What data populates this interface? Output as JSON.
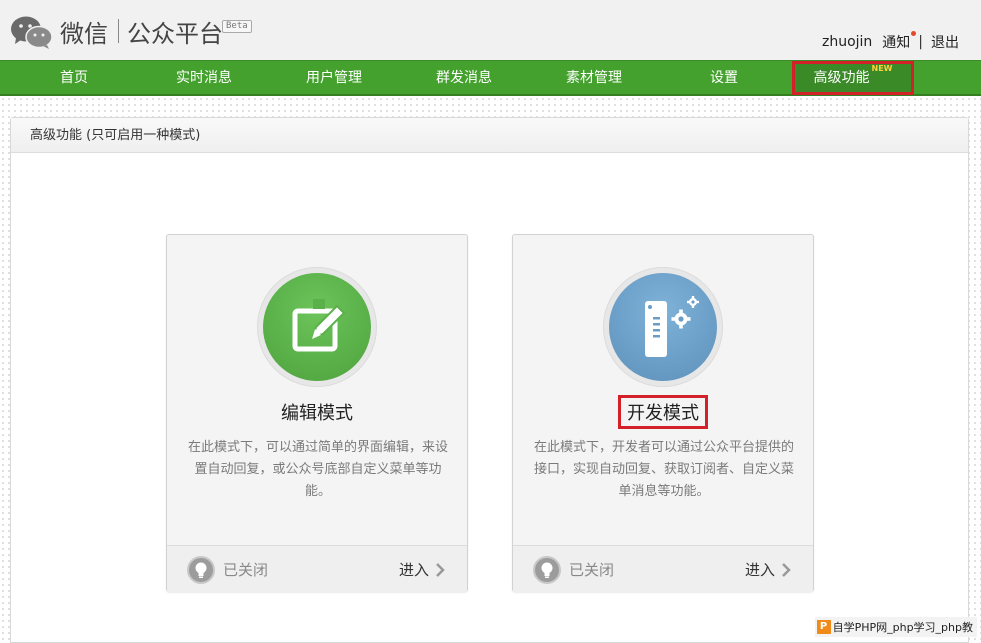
{
  "header": {
    "brand_name": "微信",
    "platform_name": "公众平台",
    "beta_label": "Beta",
    "username": "zhuojin",
    "notice_label": "通知",
    "pipe": "|",
    "logout_label": "退出"
  },
  "nav": {
    "items": [
      {
        "label": "首页"
      },
      {
        "label": "实时消息"
      },
      {
        "label": "用户管理"
      },
      {
        "label": "群发消息"
      },
      {
        "label": "素材管理"
      },
      {
        "label": "设置"
      },
      {
        "label": "高级功能",
        "badge": "NEW",
        "active": true
      }
    ],
    "bar_color": "#44a12e",
    "highlight_color": "#d3212a"
  },
  "panel": {
    "title": "高级功能 (只可启用一种模式)"
  },
  "cards": [
    {
      "title": "编辑模式",
      "description": "在此模式下，可以通过简单的界面编辑，来设置自动回复，或公众号底部自定义菜单等功能。",
      "status": "已关闭",
      "enter_label": "进入",
      "icon": "edit-icon",
      "color": "#55aa44"
    },
    {
      "title": "开发模式",
      "description": "在此模式下，开发者可以通过公众平台提供的接口，实现自动回复、获取订阅者、自定义菜单消息等功能。",
      "status": "已关闭",
      "enter_label": "进入",
      "icon": "server-gear-icon",
      "color": "#6a9cc5"
    }
  ],
  "watermark": {
    "badge": "P",
    "text": "自学PHP网_php学习_php教"
  }
}
